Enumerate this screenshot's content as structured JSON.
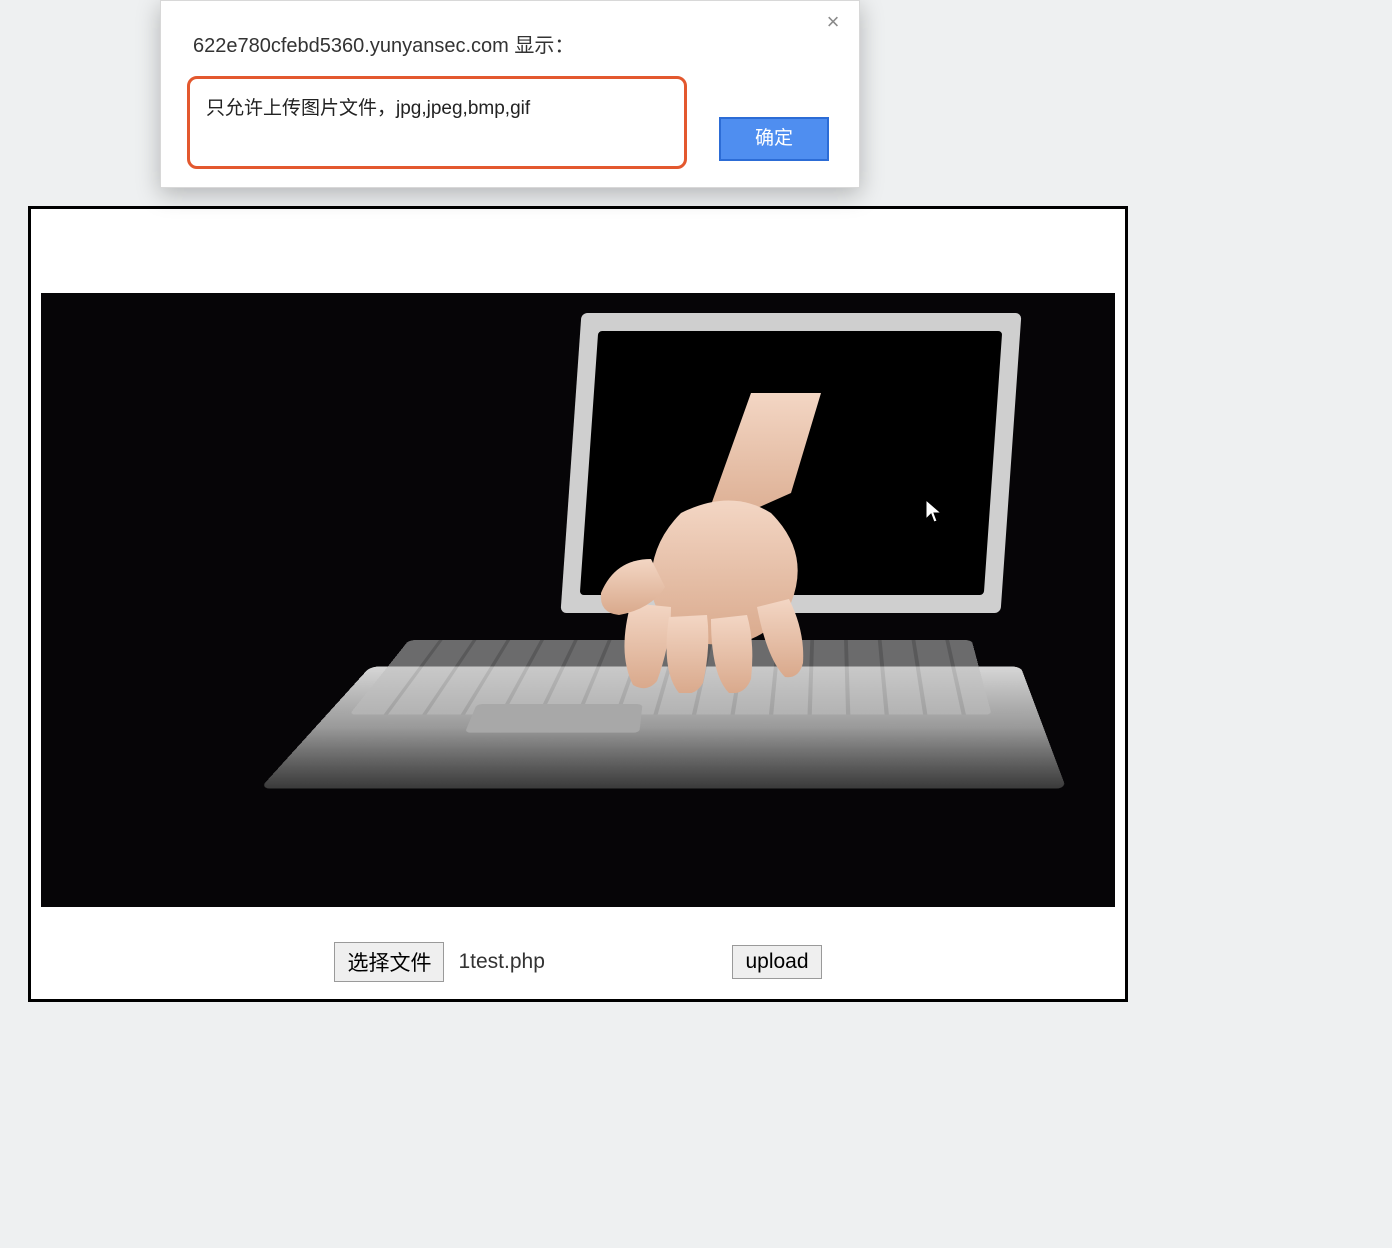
{
  "dialog": {
    "title": "622e780cfebd5360.yunyansec.com 显示：",
    "message": "只允许上传图片文件，jpg,jpeg,bmp,gif",
    "ok_label": "确定",
    "close_label": "×"
  },
  "upload": {
    "choose_label": "选择文件",
    "filename": "1test.php",
    "submit_label": "upload"
  },
  "icons": {
    "cursor": "cursor-icon"
  }
}
